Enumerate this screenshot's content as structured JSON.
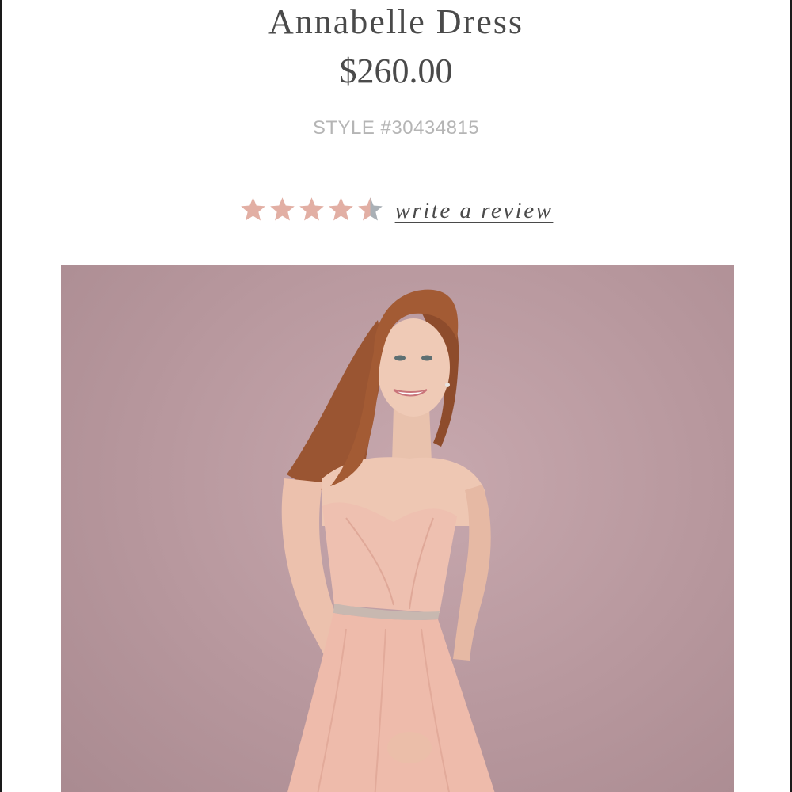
{
  "product": {
    "title": "Annabelle Dress",
    "price": "$260.00",
    "style_number": "STYLE #30434815"
  },
  "rating": {
    "stars": 4.5,
    "max_stars": 5,
    "review_link_label": "write a review",
    "colors": {
      "filled": "#e2afa4",
      "empty": "#a9b0b6"
    }
  },
  "image": {
    "alt": "Model wearing a blush pink strapless tulle dress with a beaded waist sash",
    "background_color": "#b89aa0",
    "dress_color": "#ecbcae",
    "hair_color": "#9a5532"
  }
}
